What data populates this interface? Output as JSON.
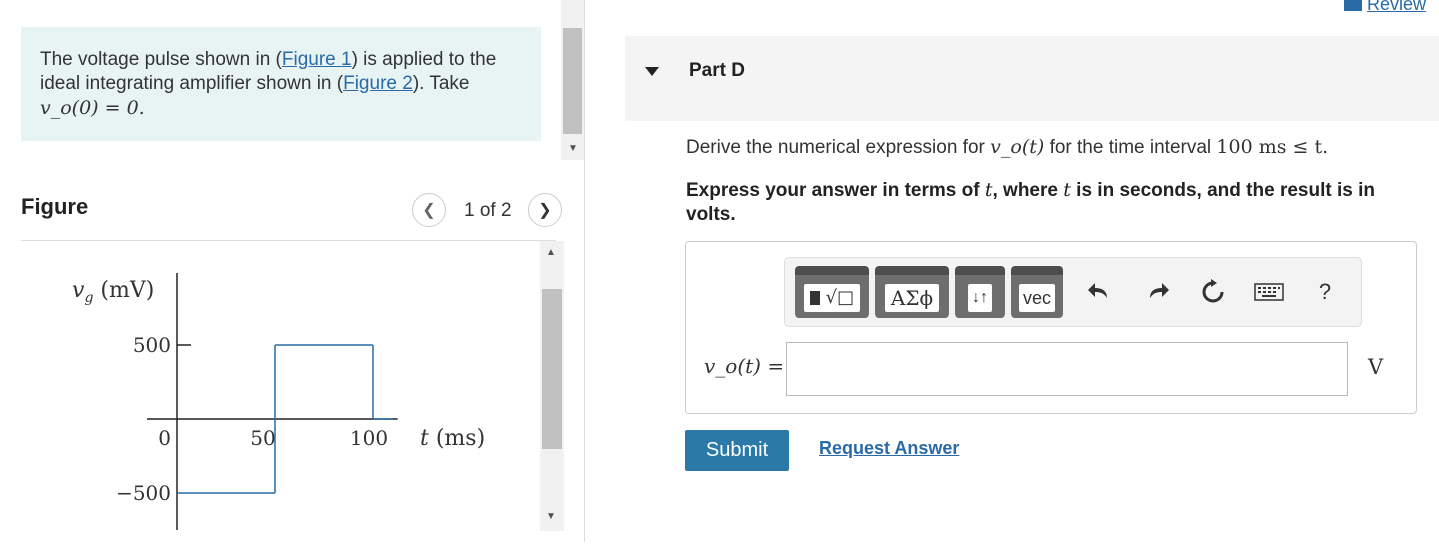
{
  "problem": {
    "text_before_fig1": "The voltage pulse shown in (",
    "figure1_link": "Figure 1",
    "text_between": ") is applied to the ideal integrating amplifier shown in (",
    "figure2_link": "Figure 2",
    "text_after": "). Take",
    "initial_condition": "v_o(0) = 0."
  },
  "figure": {
    "title": "Figure",
    "pager": "1 of 2",
    "ylabel": "v_g (mV)",
    "xlabel": "t (ms)",
    "y_ticks": [
      "500",
      "0",
      "−500"
    ],
    "x_ticks": [
      "50",
      "100"
    ]
  },
  "chart_data": {
    "type": "line",
    "x": [
      0,
      50,
      50,
      100,
      100,
      110
    ],
    "y": [
      -500,
      -500,
      500,
      500,
      0,
      0
    ],
    "xlabel": "t (ms)",
    "ylabel": "v_g (mV)",
    "xlim": [
      -10,
      110
    ],
    "ylim": [
      -600,
      600
    ]
  },
  "part": {
    "title": "Part D",
    "question_prefix": "Derive the numerical expression for",
    "question_mid": "for the time interval",
    "question_math": "100 ms ≤ t.",
    "instruction_a": "Express your answer in terms of",
    "instruction_b": ", where",
    "instruction_c": "is in seconds, and the result is in volts.",
    "t_symbol": "t",
    "vo_symbol": "v_o(t)"
  },
  "toolbar": {
    "templates_icon": "templates-icon",
    "greek_label": "ΑΣϕ",
    "arrows_label": "↓↑",
    "vec_label": "vec",
    "undo_icon": "undo-icon",
    "redo_icon": "redo-icon",
    "reset_icon": "reset-icon",
    "keyboard_icon": "keyboard-icon",
    "help_label": "?"
  },
  "answer": {
    "label": "v_o(t) =",
    "value": "",
    "unit": "V"
  },
  "actions": {
    "submit": "Submit",
    "request": "Request Answer"
  },
  "review": "Review"
}
